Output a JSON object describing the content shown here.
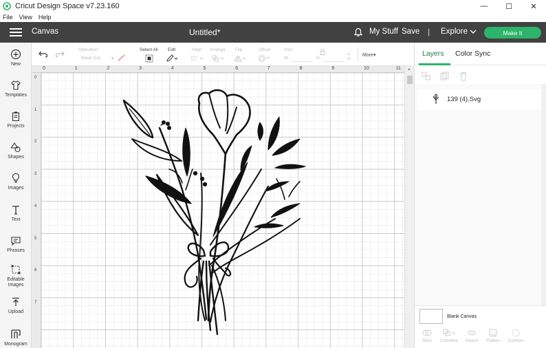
{
  "window": {
    "title": "Cricut Design Space  v7.23.160",
    "minimize": "—",
    "maximize": "☐",
    "close": "✕"
  },
  "menu": [
    "File",
    "View",
    "Help"
  ],
  "header": {
    "canvas_label": "Canvas",
    "doc_title": "Untitled*",
    "my_stuff": "My Stuff",
    "save": "Save",
    "separator": "|",
    "explore": "Explore",
    "make_it": "Make It",
    "make_it_color": "#2db36b"
  },
  "sidebar": [
    {
      "icon": "plus-circle-icon",
      "label": "New"
    },
    {
      "icon": "shirt-icon",
      "label": "Templates"
    },
    {
      "icon": "clipboard-icon",
      "label": "Projects"
    },
    {
      "icon": "shapes-icon",
      "label": "Shapes"
    },
    {
      "icon": "lightbulb-icon",
      "label": "Images"
    },
    {
      "icon": "text-t-icon",
      "label": "Text"
    },
    {
      "icon": "speech-bubble-icon",
      "label": "Phrases"
    },
    {
      "icon": "editable-images-icon",
      "label": "Editable\nImages"
    },
    {
      "icon": "upload-icon",
      "label": "Upload"
    },
    {
      "icon": "monogram-icon",
      "label": "Monogram"
    }
  ],
  "toolbar": {
    "operation_label": "Operation",
    "operation_value": "Basic Cut",
    "select_all": "Select All",
    "edit": "Edit",
    "align": "Align",
    "arrange": "Arrange",
    "flip": "Flip",
    "offset": "Offset",
    "size": "Size",
    "w": "W",
    "h": "H",
    "more": "More▾"
  },
  "ruler": {
    "top": [
      "0",
      "1",
      "2",
      "3",
      "4",
      "5",
      "6",
      "7",
      "8",
      "9",
      "10",
      "11"
    ],
    "left": [
      "0",
      "1",
      "2",
      "3",
      "4",
      "5",
      "6",
      "7"
    ]
  },
  "panel": {
    "tabs": [
      "Layers",
      "Color Sync"
    ],
    "active_tab": "Layers",
    "layer_name": "139 (4).Svg",
    "blank_canvas": "Blank Canvas",
    "bottom_tools": [
      "Slice",
      "Combine",
      "Attach",
      "Flatten",
      "Contour"
    ]
  },
  "colors": {
    "header_bg": "#414141",
    "accent_green": "#2db36b"
  }
}
